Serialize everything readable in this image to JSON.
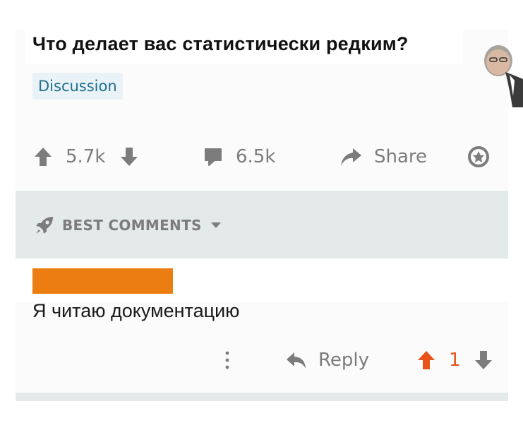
{
  "post": {
    "title": "Что делает вас статистически редким?",
    "flair": "Discussion",
    "upvotes": "5.7k",
    "comments": "6.5k",
    "share_label": "Share"
  },
  "comments_section": {
    "sort_label": "BEST COMMENTS"
  },
  "comment": {
    "text": "Я читаю документацию",
    "reply_label": "Reply",
    "score": "1",
    "score_color": "#e8531b"
  },
  "colors": {
    "accent_orange": "#ec7d11",
    "flair_text": "#1f6f8d",
    "icon_gray": "#7c7c7c"
  }
}
